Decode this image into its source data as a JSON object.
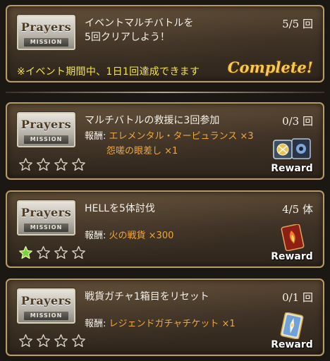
{
  "badge": {
    "title": "Prayers",
    "sub": "MISSION"
  },
  "top_mission": {
    "title_line1": "イベントマルチバトルを",
    "title_line2": "5回クリアしよう！",
    "progress": "5/5 回",
    "note": "※イベント期間中、1日1回達成できます",
    "status": "Complete!"
  },
  "missions": [
    {
      "title": "マルチバトルの救援に3回参加",
      "progress": "0/3 回",
      "reward_key": "報酬:",
      "reward_line1": "エレメンタル・ターピュランス ×3",
      "reward_line2": "怨嗟の眼差し ×1",
      "stars_filled": 0,
      "reward_button": "Reward",
      "reward_icon": "element-orb-icon"
    },
    {
      "title": "HELLを5体討伐",
      "progress": "4/5 体",
      "reward_key": "報酬:",
      "reward_line1": "火の戦貨 ×300",
      "reward_line2": "",
      "stars_filled": 1,
      "reward_button": "Reward",
      "reward_icon": "fire-coin-icon"
    },
    {
      "title": "戦貨ガチャ1箱目をリセット",
      "progress": "0/1 回",
      "reward_key": "報酬:",
      "reward_line1": "レジェンドガチャチケット ×1",
      "reward_line2": "",
      "stars_filled": 0,
      "reward_button": "Reward",
      "reward_icon": "gacha-ticket-icon"
    }
  ],
  "colors": {
    "accent_gold": "#f3c952",
    "reward_orange": "#f0a83a",
    "note_yellow": "#f2e54a",
    "star_filled": "#7ed13a"
  }
}
